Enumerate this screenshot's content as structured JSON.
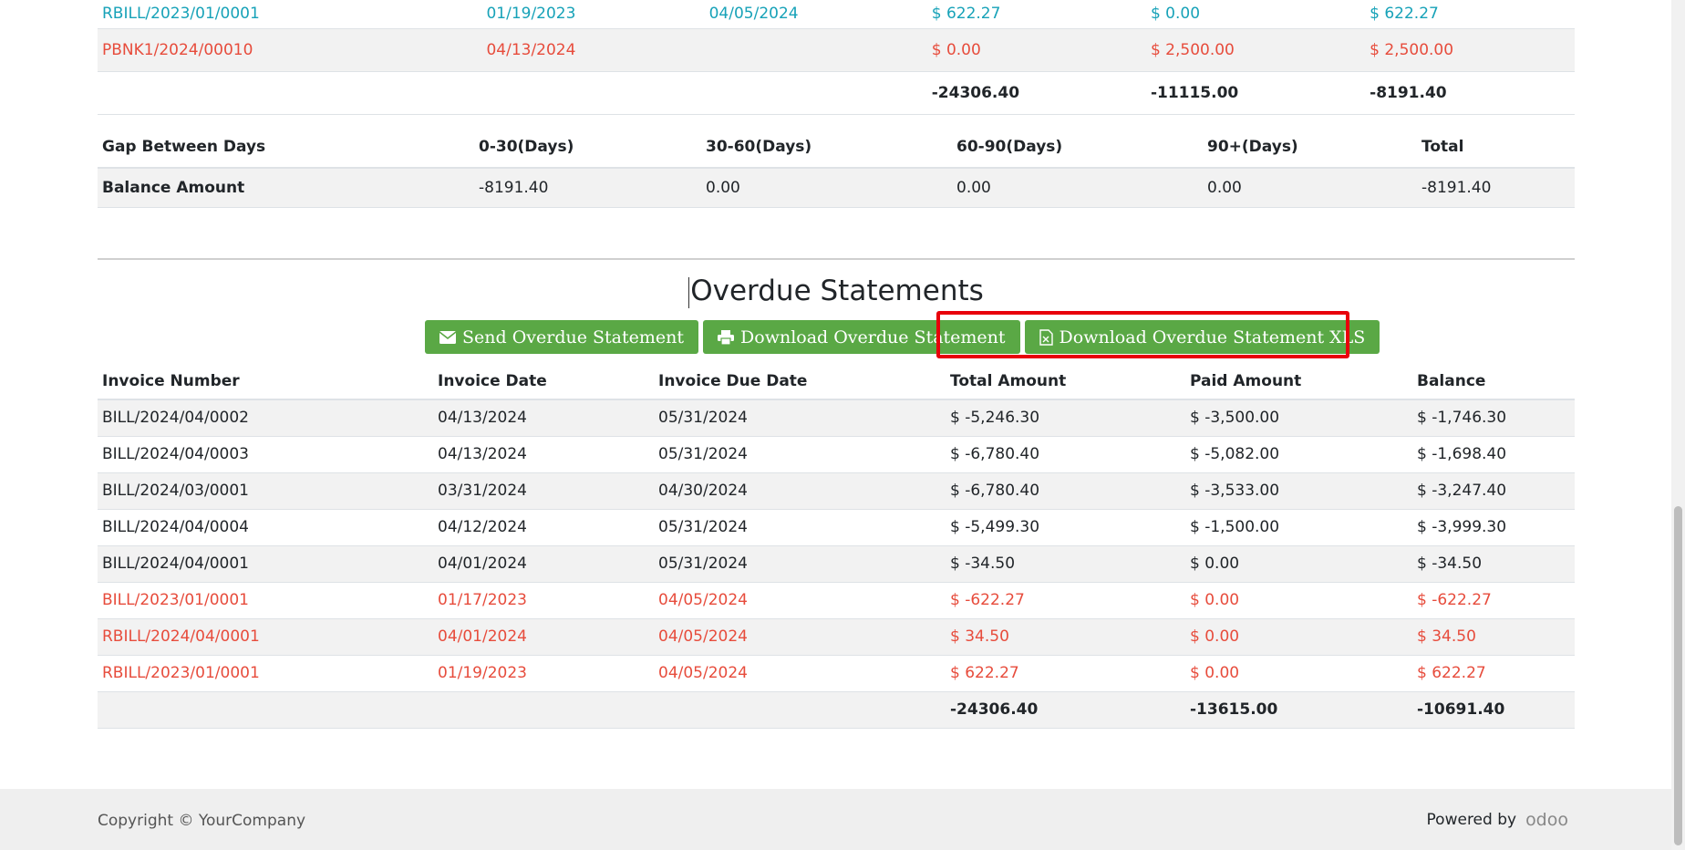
{
  "top_table": {
    "rows": [
      {
        "color": "teal",
        "cells": [
          "RBILL/2023/01/0001",
          "01/19/2023",
          "04/05/2024",
          "$ 622.27",
          "$ 0.00",
          "$ 622.27"
        ]
      },
      {
        "color": "red",
        "cells": [
          "PBNK1/2024/00010",
          "04/13/2024",
          "",
          "$ 0.00",
          "$ 2,500.00",
          "$ 2,500.00"
        ]
      }
    ],
    "totals": [
      "",
      "",
      "",
      "-24306.40",
      "-11115.00",
      "-8191.40"
    ]
  },
  "aging": {
    "headers": [
      "Gap Between Days",
      "0-30(Days)",
      "30-60(Days)",
      "60-90(Days)",
      "90+(Days)",
      "Total"
    ],
    "row": [
      "Balance Amount",
      "-8191.40",
      "0.00",
      "0.00",
      "0.00",
      "-8191.40"
    ]
  },
  "overdue": {
    "title": "Overdue Statements",
    "buttons": {
      "send": "Send Overdue Statement",
      "download": "Download Overdue Statement",
      "download_xls": "Download Overdue Statement XLS"
    },
    "headers": [
      "Invoice Number",
      "Invoice Date",
      "Invoice Due Date",
      "Total Amount",
      "Paid Amount",
      "Balance"
    ],
    "rows": [
      {
        "color": "normal",
        "cells": [
          "BILL/2024/04/0002",
          "04/13/2024",
          "05/31/2024",
          "$ -5,246.30",
          "$ -3,500.00",
          "$ -1,746.30"
        ]
      },
      {
        "color": "normal",
        "cells": [
          "BILL/2024/04/0003",
          "04/13/2024",
          "05/31/2024",
          "$ -6,780.40",
          "$ -5,082.00",
          "$ -1,698.40"
        ]
      },
      {
        "color": "normal",
        "cells": [
          "BILL/2024/03/0001",
          "03/31/2024",
          "04/30/2024",
          "$ -6,780.40",
          "$ -3,533.00",
          "$ -3,247.40"
        ]
      },
      {
        "color": "normal",
        "cells": [
          "BILL/2024/04/0004",
          "04/12/2024",
          "05/31/2024",
          "$ -5,499.30",
          "$ -1,500.00",
          "$ -3,999.30"
        ]
      },
      {
        "color": "normal",
        "cells": [
          "BILL/2024/04/0001",
          "04/01/2024",
          "05/31/2024",
          "$ -34.50",
          "$ 0.00",
          "$ -34.50"
        ]
      },
      {
        "color": "red",
        "cells": [
          "BILL/2023/01/0001",
          "01/17/2023",
          "04/05/2024",
          "$ -622.27",
          "$ 0.00",
          "$ -622.27"
        ]
      },
      {
        "color": "red",
        "cells": [
          "RBILL/2024/04/0001",
          "04/01/2024",
          "04/05/2024",
          "$ 34.50",
          "$ 0.00",
          "$ 34.50"
        ]
      },
      {
        "color": "red",
        "cells": [
          "RBILL/2023/01/0001",
          "01/19/2023",
          "04/05/2024",
          "$ 622.27",
          "$ 0.00",
          "$ 622.27"
        ]
      }
    ],
    "totals": [
      "",
      "",
      "",
      "-24306.40",
      "-13615.00",
      "-10691.40"
    ]
  },
  "footer": {
    "copyright": "Copyright © YourCompany",
    "powered_by": "Powered by",
    "brand": "odoo"
  },
  "colors": {
    "teal": "#17a2b8",
    "red": "#e74c3c",
    "button_green": "#5aa845",
    "highlight": "#e8000b"
  }
}
